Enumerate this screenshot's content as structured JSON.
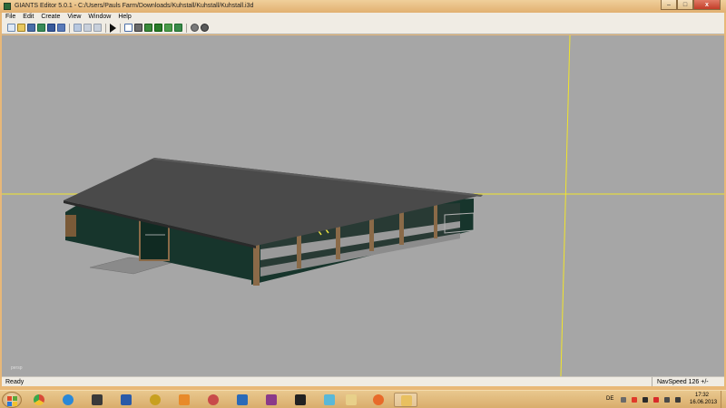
{
  "window": {
    "title": "GIANTS Editor 5.0.1 - C:/Users/Pauls Farm/Downloads/Kuhstall/Kuhstall/Kuhstall.i3d",
    "controls": {
      "minimize": "–",
      "maximize": "□",
      "close": "x"
    }
  },
  "menubar": {
    "items": [
      "File",
      "Edit",
      "Create",
      "View",
      "Window",
      "Help"
    ]
  },
  "toolbar": {
    "icons": [
      "new-file-icon",
      "open-file-icon",
      "save-icon",
      "save-as-icon",
      "export-icon",
      "undo-icon",
      "redo-icon",
      "cut-icon",
      "copy-icon",
      "play-icon",
      "select-icon",
      "move-icon",
      "rotate-icon",
      "scale-icon",
      "terrain-icon",
      "paint-icon",
      "settings-icon",
      "lock-icon"
    ]
  },
  "viewport": {
    "camera_label": "persp"
  },
  "statusbar": {
    "status": "Ready",
    "navspeed": "NavSpeed 126 +/-"
  },
  "taskbar": {
    "apps": [
      "chrome-icon",
      "internet-explorer-icon",
      "tool-icon",
      "giants-editor-icon",
      "gold-app-icon",
      "media-player-icon",
      "paint-app-icon",
      "remote-desktop-icon",
      "archive-icon",
      "qr-app-icon",
      "notes-icon",
      "explorer-icon",
      "fish-app-icon",
      "folder-icon"
    ],
    "active_index": 13
  },
  "tray": {
    "language": "DE",
    "time": "17:32",
    "date": "16.06.2013"
  },
  "colors": {
    "taskbar": "#e0b77a",
    "viewport": "#a6a6a6",
    "axis_line": "#f2e52a",
    "barn_wall": "#16332a",
    "roof": "#4a4a4a"
  }
}
